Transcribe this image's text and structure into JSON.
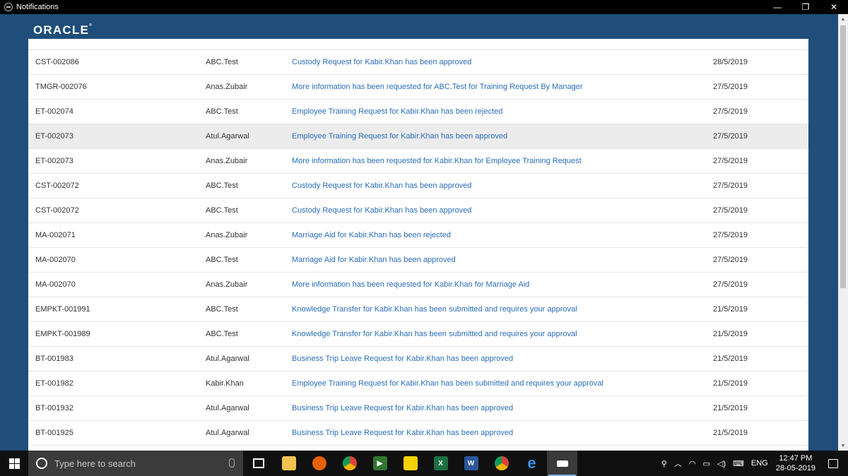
{
  "window": {
    "title": "Notifications",
    "minimize": "—",
    "restore": "❐",
    "close": "✕"
  },
  "brand": {
    "logo_text": "ORACLE",
    "logo_mark": "®"
  },
  "notifications": [
    {
      "id": "CST-002086",
      "from": "ABC.Test",
      "message": "Custody Request for Kabir.Khan has been approved",
      "date": "28/5/2019"
    },
    {
      "id": "TMGR-002076",
      "from": "Anas.Zubair",
      "message": "More information has been requested for ABC.Test for Training Request By Manager",
      "date": "27/5/2019"
    },
    {
      "id": "ET-002074",
      "from": "ABC.Test",
      "message": "Employee Training Request for Kabir.Khan has been rejected",
      "date": "27/5/2019"
    },
    {
      "id": "ET-002073",
      "from": "Atul.Agarwal",
      "message": "Employee Training Request for Kabir.Khan has been approved",
      "date": "27/5/2019"
    },
    {
      "id": "ET-002073",
      "from": "Anas.Zubair",
      "message": "More information has been requested for Kabir.Khan for Employee Training Request",
      "date": "27/5/2019"
    },
    {
      "id": "CST-002072",
      "from": "ABC.Test",
      "message": "Custody Request for Kabir.Khan has been approved",
      "date": "27/5/2019"
    },
    {
      "id": "CST-002072",
      "from": "ABC.Test",
      "message": "Custody Request for Kabir.Khan has been approved",
      "date": "27/5/2019"
    },
    {
      "id": "MA-002071",
      "from": "Anas.Zubair",
      "message": "Marriage Aid for Kabir.Khan has been rejected",
      "date": "27/5/2019"
    },
    {
      "id": "MA-002070",
      "from": "ABC.Test",
      "message": "Marriage Aid for Kabir.Khan has been approved",
      "date": "27/5/2019"
    },
    {
      "id": "MA-002070",
      "from": "Anas.Zubair",
      "message": "More information has been requested for Kabir.Khan for Marriage Aid",
      "date": "27/5/2019"
    },
    {
      "id": "EMPKT-001991",
      "from": "ABC.Test",
      "message": "Knowledge Transfer for Kabir.Khan has been submitted and requires your approval",
      "date": "21/5/2019"
    },
    {
      "id": "EMPKT-001989",
      "from": "ABC.Test",
      "message": "Knowledge Transfer for Kabir.Khan has been submitted and requires your approval",
      "date": "21/5/2019"
    },
    {
      "id": "BT-001983",
      "from": "Atul.Agarwal",
      "message": "Business Trip Leave Request for Kabir.Khan has been approved",
      "date": "21/5/2019"
    },
    {
      "id": "ET-001982",
      "from": "Kabir.Khan",
      "message": "Employee Training Request for Kabir.Khan has been submitted and requires your approval",
      "date": "21/5/2019"
    },
    {
      "id": "BT-001932",
      "from": "Atul.Agarwal",
      "message": "Business Trip Leave Request for Kabir.Khan has been approved",
      "date": "21/5/2019"
    },
    {
      "id": "BT-001925",
      "from": "Atul.Agarwal",
      "message": "Business Trip Leave Request for Kabir.Khan has been approved",
      "date": "21/5/2019"
    }
  ],
  "taskbar": {
    "search_placeholder": "Type here to search",
    "language": "ENG",
    "time": "12:47 PM",
    "date": "28-05-2019",
    "apps": [
      "file-explorer-icon",
      "firefox-icon",
      "chrome-icon",
      "project-icon",
      "sticky-notes-icon",
      "excel-icon",
      "word-icon",
      "chrome-alt-icon",
      "edge-icon",
      "notifications-app-icon"
    ]
  },
  "colors": {
    "background": "#1e4e79",
    "link": "#2a6ebb",
    "highlight_row": "#ececec"
  }
}
